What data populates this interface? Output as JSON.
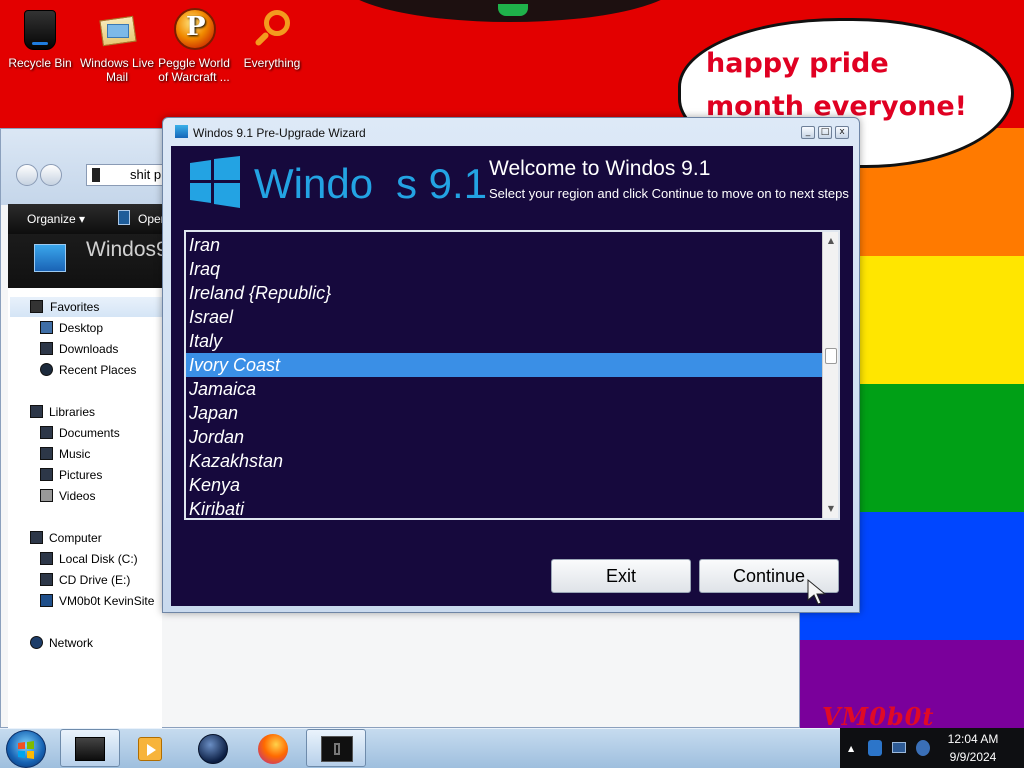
{
  "desktop": {
    "icons": [
      {
        "label": "Recycle Bin",
        "icon": "recycle-bin-icon"
      },
      {
        "label": "Windows Live Mail",
        "icon": "mail-icon"
      },
      {
        "label": "Peggle World of Warcraft ...",
        "icon": "peggle-icon"
      },
      {
        "label": "Everything",
        "icon": "magnifier-icon"
      }
    ],
    "speech_bubble": "happy pride month everyone!",
    "watermark": "VM0b0t",
    "colors": {
      "red": "#e30000",
      "orange": "#ff7a00",
      "yellow": "#ffe600",
      "green": "#00a016",
      "blue": "#0046ff",
      "purple": "#7a009b"
    }
  },
  "explorer": {
    "address": "shit p",
    "toolbar": {
      "organize": "Organize",
      "open": "Open"
    },
    "banner_title": "Windos9",
    "nav": {
      "favorites": "Favorites",
      "desktop": "Desktop",
      "downloads": "Downloads",
      "recent_places": "Recent Places",
      "libraries": "Libraries",
      "documents": "Documents",
      "music": "Music",
      "pictures": "Pictures",
      "videos": "Videos",
      "computer": "Computer",
      "local_disk": "Local Disk (C:)",
      "cd_drive": "CD Drive (E:)",
      "vm0b0t_site": "VM0b0t KevinSite",
      "network": "Network"
    }
  },
  "wizard": {
    "title": "Windos 9.1 Pre-Upgrade Wizard",
    "logo_text": "Windo",
    "logo_version": "s 9.1",
    "heading": "Welcome to Windos 9.1",
    "instructions": "Select your region and click Continue to move on to next steps",
    "regions": [
      "Iran",
      "Iraq",
      "Ireland {Republic}",
      "Israel",
      "Italy",
      "Ivory Coast",
      "Jamaica",
      "Japan",
      "Jordan",
      "Kazakhstan",
      "Kenya",
      "Kiribati"
    ],
    "selected_region": "Ivory Coast",
    "buttons": {
      "exit": "Exit",
      "continue": "Continue"
    },
    "controls": {
      "minimize": "_",
      "maximize": "□",
      "close": "x"
    }
  },
  "taskbar": {
    "pinned": [
      "explorer-icon",
      "media-player-icon",
      "globe-icon",
      "firefox-icon",
      "terminal-icon"
    ],
    "clock": {
      "time": "12:04 AM",
      "date": "9/9/2024"
    }
  }
}
